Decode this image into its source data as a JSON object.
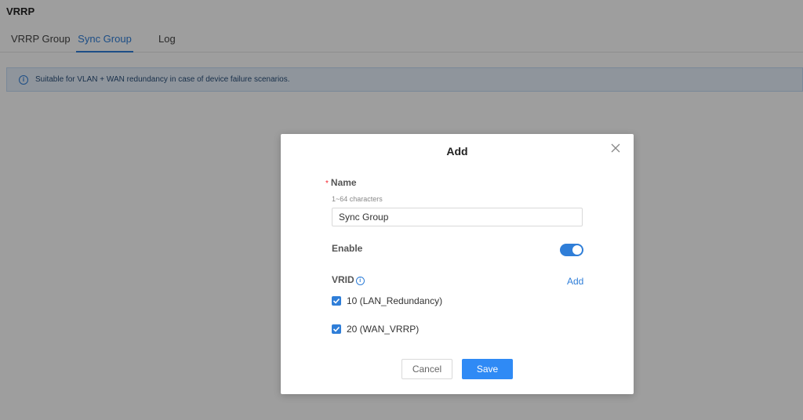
{
  "page": {
    "title": "VRRP",
    "tabs": [
      {
        "label": "VRRP Group",
        "active": false
      },
      {
        "label": "Sync Group",
        "active": true
      },
      {
        "label": "Log",
        "active": false
      }
    ],
    "info": "Suitable for VLAN + WAN redundancy in case of device failure scenarios."
  },
  "modal": {
    "title": "Add",
    "name_label": "Name",
    "name_required_mark": "*",
    "name_hint": "1~64 characters",
    "name_value": "Sync Group",
    "enable_label": "Enable",
    "enable_on": true,
    "vrid_label": "VRID",
    "add_label": "Add",
    "vrids": [
      {
        "label": "10 (LAN_Redundancy)",
        "checked": true
      },
      {
        "label": "20 (WAN_VRRP)",
        "checked": true
      }
    ],
    "cancel_label": "Cancel",
    "save_label": "Save"
  },
  "colors": {
    "accent": "#2f7ed8",
    "button_primary": "#2f8af5",
    "required": "#f5222d",
    "info_bg": "#e7f1fc"
  },
  "icons": [
    "info-icon",
    "close-icon",
    "checkbox-checked-icon"
  ]
}
